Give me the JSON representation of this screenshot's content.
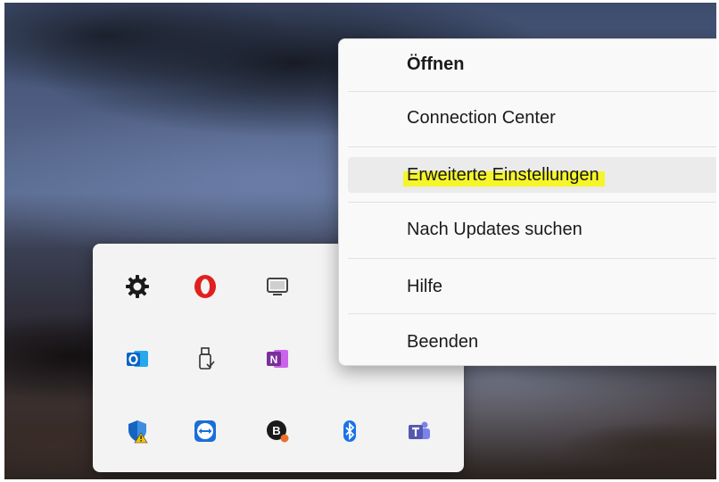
{
  "menu": {
    "items": [
      {
        "label": "Öffnen",
        "bold": true
      },
      {
        "label": "Connection Center"
      },
      {
        "label": "Erweiterte Einstellungen",
        "highlighted": true
      },
      {
        "label": "Nach Updates suchen"
      },
      {
        "label": "Hilfe"
      },
      {
        "label": "Beenden"
      }
    ]
  },
  "tray": {
    "icons": [
      {
        "name": "settings-gear-icon"
      },
      {
        "name": "opera-icon",
        "color": "#e0201f"
      },
      {
        "name": "screen-icon"
      },
      {
        "name": "outlook-icon",
        "color": "#0a64c4"
      },
      {
        "name": "usb-drive-icon"
      },
      {
        "name": "onenote-icon",
        "color": "#7a2f9c",
        "letter": "N"
      },
      {
        "name": "windows-security-icon",
        "color": "#1565c0"
      },
      {
        "name": "teamviewer-icon",
        "color": "#1a6fd8"
      },
      {
        "name": "b-app-icon",
        "letter": "B"
      },
      {
        "name": "bluetooth-icon",
        "color": "#1a73e8"
      },
      {
        "name": "teams-icon",
        "color": "#5558af"
      }
    ]
  }
}
